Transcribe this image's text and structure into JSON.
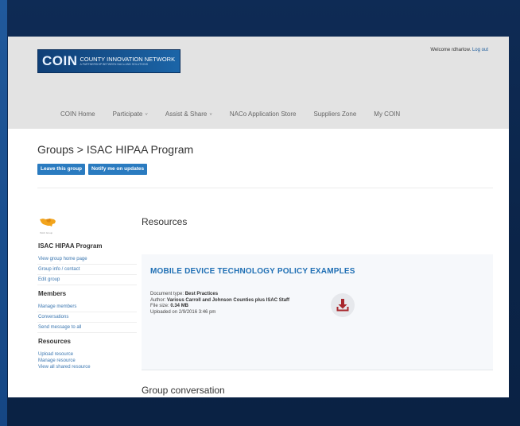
{
  "header": {
    "logo": {
      "mark": "COIN",
      "name": "COUNTY INNOVATION NETWORK",
      "subtitle": "A PARTNERSHIP BETWEEN NACo AND SOLUTIONS"
    },
    "welcome_text": "Welcome rdharlow.",
    "logout_label": "Log out",
    "nav": [
      {
        "label": "COIN Home",
        "has_caret": false
      },
      {
        "label": "Participate",
        "has_caret": true
      },
      {
        "label": "Assist & Share",
        "has_caret": true
      },
      {
        "label": "NACo Application Store",
        "has_caret": false
      },
      {
        "label": "Suppliers Zone",
        "has_caret": false
      },
      {
        "label": "My COIN",
        "has_caret": false
      }
    ],
    "nav_caret": "˅"
  },
  "page": {
    "title": "Groups > ISAC HIPAA Program",
    "buttons": {
      "leave": "Leave this group",
      "notify": "Notify me on updates"
    }
  },
  "sidebar": {
    "group_name": "ISAC HIPAA Program",
    "map_caption": "ISAC Group",
    "group_links": [
      "View group home page",
      "Group info / contact",
      "Edit group"
    ],
    "members_heading": "Members",
    "members_links": [
      "Manage members",
      "Conversations",
      "Send message to all"
    ],
    "resources_heading": "Resources",
    "resources_links": [
      "Upload resource",
      "Manage resource",
      "View all shared resource"
    ]
  },
  "main": {
    "resources_heading": "Resources",
    "document": {
      "title": "MOBILE DEVICE TECHNOLOGY POLICY EXAMPLES",
      "type_label": "Document type:",
      "type_value": "Best Practices",
      "author_label": "Author:",
      "author_value": "Various Carroll and Johnson Counties plus ISAC Staff",
      "size_label": "File size:",
      "size_value": "0.34 MB",
      "uploaded": "Uploaded on 2/9/2016 3:46 pm",
      "download_icon": "download-icon",
      "icon_color": "#a8272d"
    },
    "conversation_heading": "Group conversation"
  },
  "colors": {
    "frame_bg": "#0d2a52",
    "header_bg": "#e3e3e3",
    "button_bg": "#2a7bc0",
    "link": "#3a76b0",
    "doc_title": "#1f6fb4"
  }
}
